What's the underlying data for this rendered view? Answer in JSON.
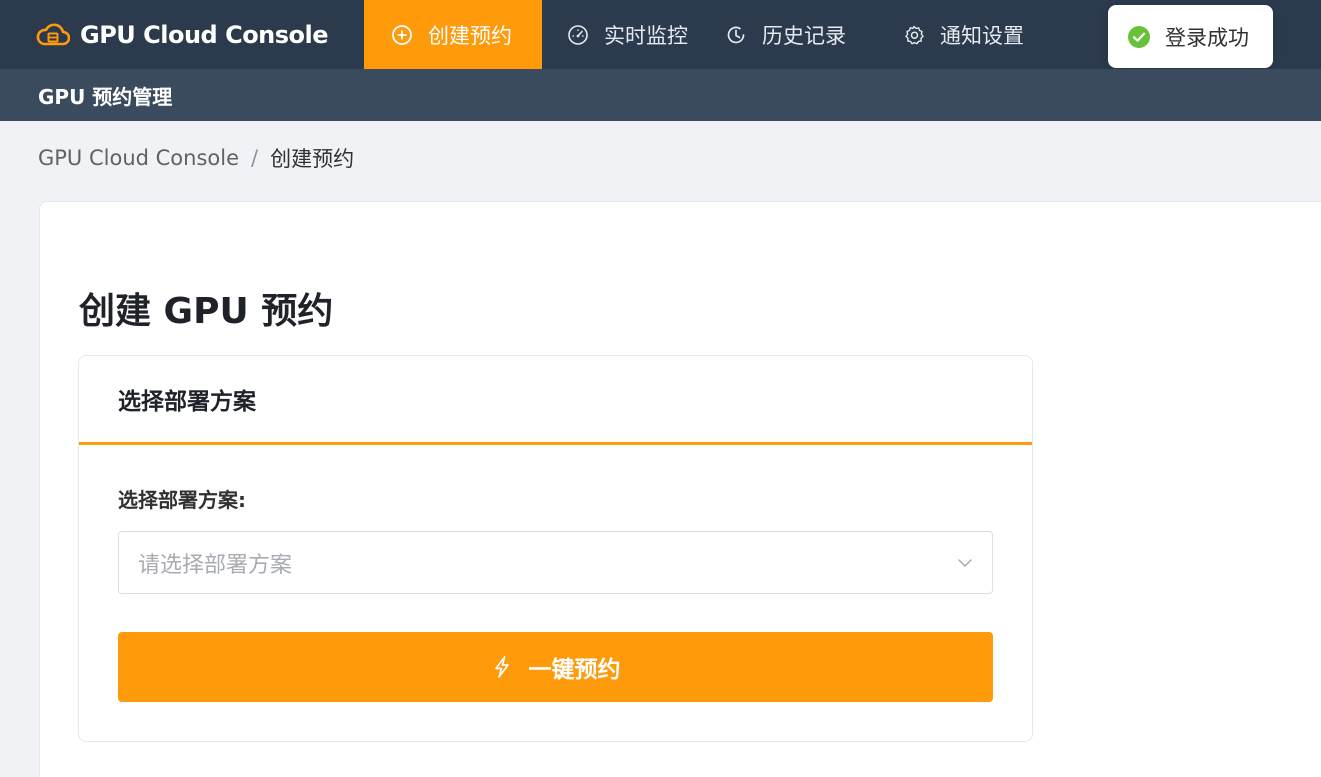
{
  "app": {
    "title": "GPU Cloud Console",
    "icon": "cloud-server-icon",
    "accent_color": "#ff9a0b"
  },
  "nav": {
    "items": [
      {
        "label": "创建预约",
        "icon": "plus-circle-icon",
        "active": true
      },
      {
        "label": "实时监控",
        "icon": "gauge-icon",
        "active": false
      },
      {
        "label": "历史记录",
        "icon": "history-icon",
        "active": false
      },
      {
        "label": "通知设置",
        "icon": "gear-icon",
        "active": false
      }
    ]
  },
  "toast": {
    "message": "登录成功",
    "icon": "check-circle-icon",
    "color": "#67c23a"
  },
  "subheader": {
    "title": "GPU 预约管理"
  },
  "breadcrumb": {
    "root": "GPU Cloud Console",
    "separator": "/",
    "current": "创建预约"
  },
  "page": {
    "title": "创建 GPU 预约"
  },
  "panel": {
    "header": "选择部署方案",
    "field_label": "选择部署方案:",
    "select_placeholder": "请选择部署方案",
    "select_icon": "chevron-down-icon",
    "button_label": "一键预约",
    "button_icon": "lightning-icon"
  }
}
